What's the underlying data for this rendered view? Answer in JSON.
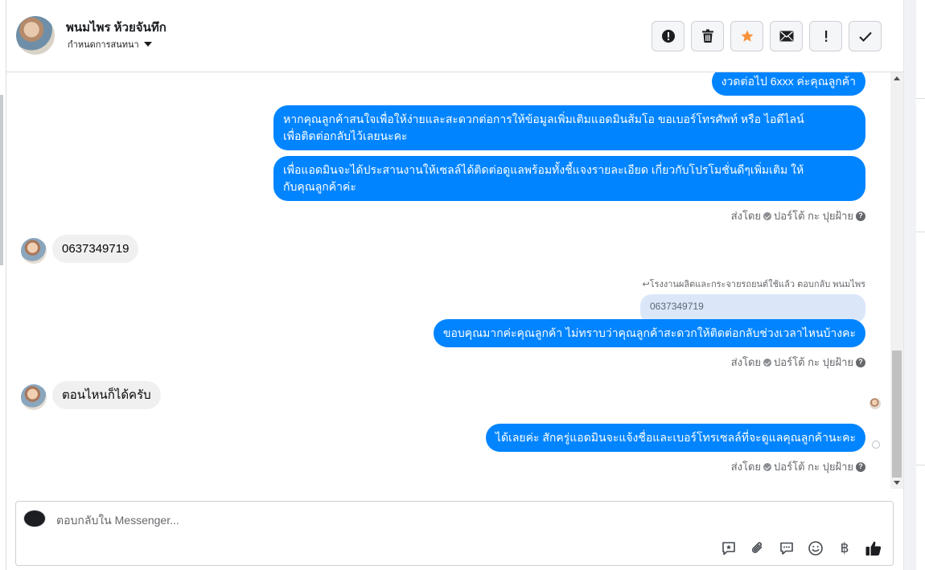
{
  "header": {
    "contact_name": "พนมไพร ห้วยจันทึก",
    "conversation_menu_label": "กำหนดการสนทนา",
    "actions": [
      {
        "name": "spam",
        "icon": "alert-circle-icon"
      },
      {
        "name": "delete",
        "icon": "trash-icon"
      },
      {
        "name": "star",
        "icon": "star-icon",
        "color": "#f7923b"
      },
      {
        "name": "mark-unread",
        "icon": "envelope-icon"
      },
      {
        "name": "follow-up",
        "icon": "exclamation-icon"
      },
      {
        "name": "done",
        "icon": "checkmark-icon"
      }
    ]
  },
  "messages": {
    "m1": "งวดต่อไป 6xxx ค่ะคุณลูกค้า",
    "m2_line1": "หากคุณลูกค้าสนใจเพื่อให้ง่ายและสะดวกต่อการให้ข้อมูลเพิ่มเติมแอดมินส้มโอ ขอเบอร์โทรศัพท์ หรือ ไอดีไลน์",
    "m2_line2": "เพื่อติดต่อกลับไว้เลยนะคะ",
    "m3_line1": "เพื่อแอดมินจะได้ประสานงานให้เซลล์ได้ติดต่อดูแลพร้อมทั้งชี้แจงรายละเอียด เกี่ยวกับโปรโมชั่นดีๆเพิ่มเติม ให้",
    "m3_line2": "กับคุณลูกค้าค่ะ",
    "sent_by_1": "ส่งโดย",
    "sender_1": "ปอร์โต้ กะ ปุยฝ้าย",
    "in1": "0637349719",
    "reply_note": "โรงงานผลิตและกระจายรถยนต์ใช้แล้ว ตอบกลับ พนมไพร",
    "quoted": "0637349719",
    "m4": "ขอบคุณมากค่ะคุณลูกค้า ไม่ทราบว่าคุณลูกค้าสะดวกให้ติดต่อกลับช่วงเวลาไหนบ้างคะ",
    "sent_by_2": "ส่งโดย",
    "sender_2": "ปอร์โต้ กะ ปุยฝ้าย",
    "in2": "ตอนไหนก็ได้ครับ",
    "m5": "ได้เลยค่ะ สักครู่แอดมินจะแจ้งชื่อและเบอร์โทรเซลล์ที่จะดูแลคุณลูกค้านะคะ",
    "sent_by_3": "ส่งโดย",
    "sender_3": "ปอร์โต้ กะ ปุยฝ้าย",
    "help": "?"
  },
  "composer": {
    "placeholder": "ตอบกลับใน Messenger...",
    "tools": [
      "saved-reply-icon",
      "attachment-icon",
      "chat-bubble-icon",
      "emoji-icon",
      "baht-icon",
      "like-icon"
    ],
    "baht_glyph": "฿"
  },
  "colors": {
    "outgoing_bubble": "#0084ff",
    "incoming_bubble": "#f0f0f0",
    "star": "#f7923b"
  }
}
